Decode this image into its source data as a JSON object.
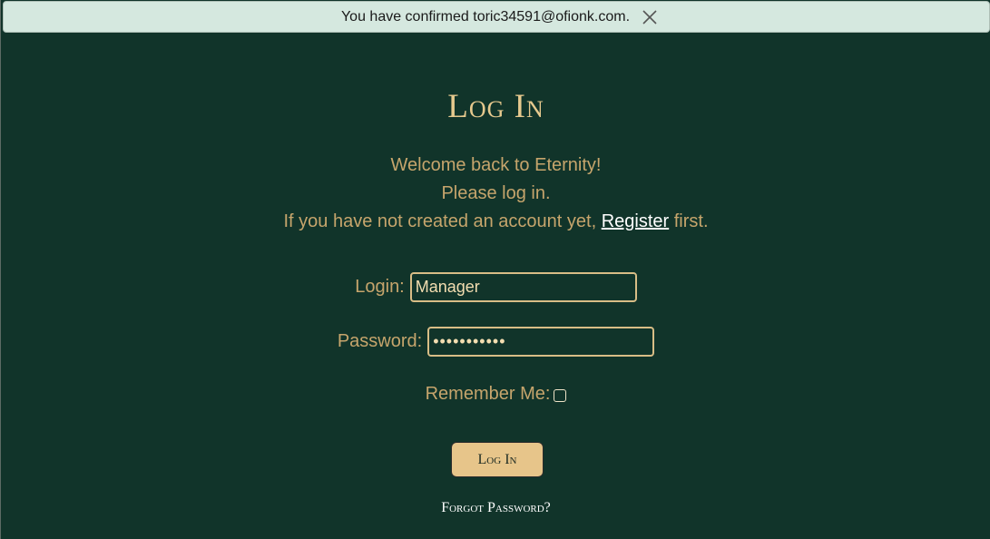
{
  "flash": {
    "message": "You have confirmed toric34591@ofionk.com.",
    "close_icon": "close-icon"
  },
  "page": {
    "title": "Log In",
    "welcome": "Welcome back to Eternity!",
    "please": "Please log in.",
    "register_prefix": "If you have not created an account yet, ",
    "register_link": "Register",
    "register_suffix": " first."
  },
  "form": {
    "login_label": "Login:",
    "login_value": "Manager",
    "password_label": "Password:",
    "password_value": "•••••••••••",
    "remember_label": "Remember Me:",
    "remember_checked": false,
    "submit_label": "Log In",
    "forgot_label": "Forgot Password?"
  },
  "colors": {
    "background": "#11342a",
    "accent_gold": "#e6c98e",
    "text_gold": "#c6a56c",
    "flash_bg": "#d5e8df",
    "button_bg": "#e7c58a"
  }
}
